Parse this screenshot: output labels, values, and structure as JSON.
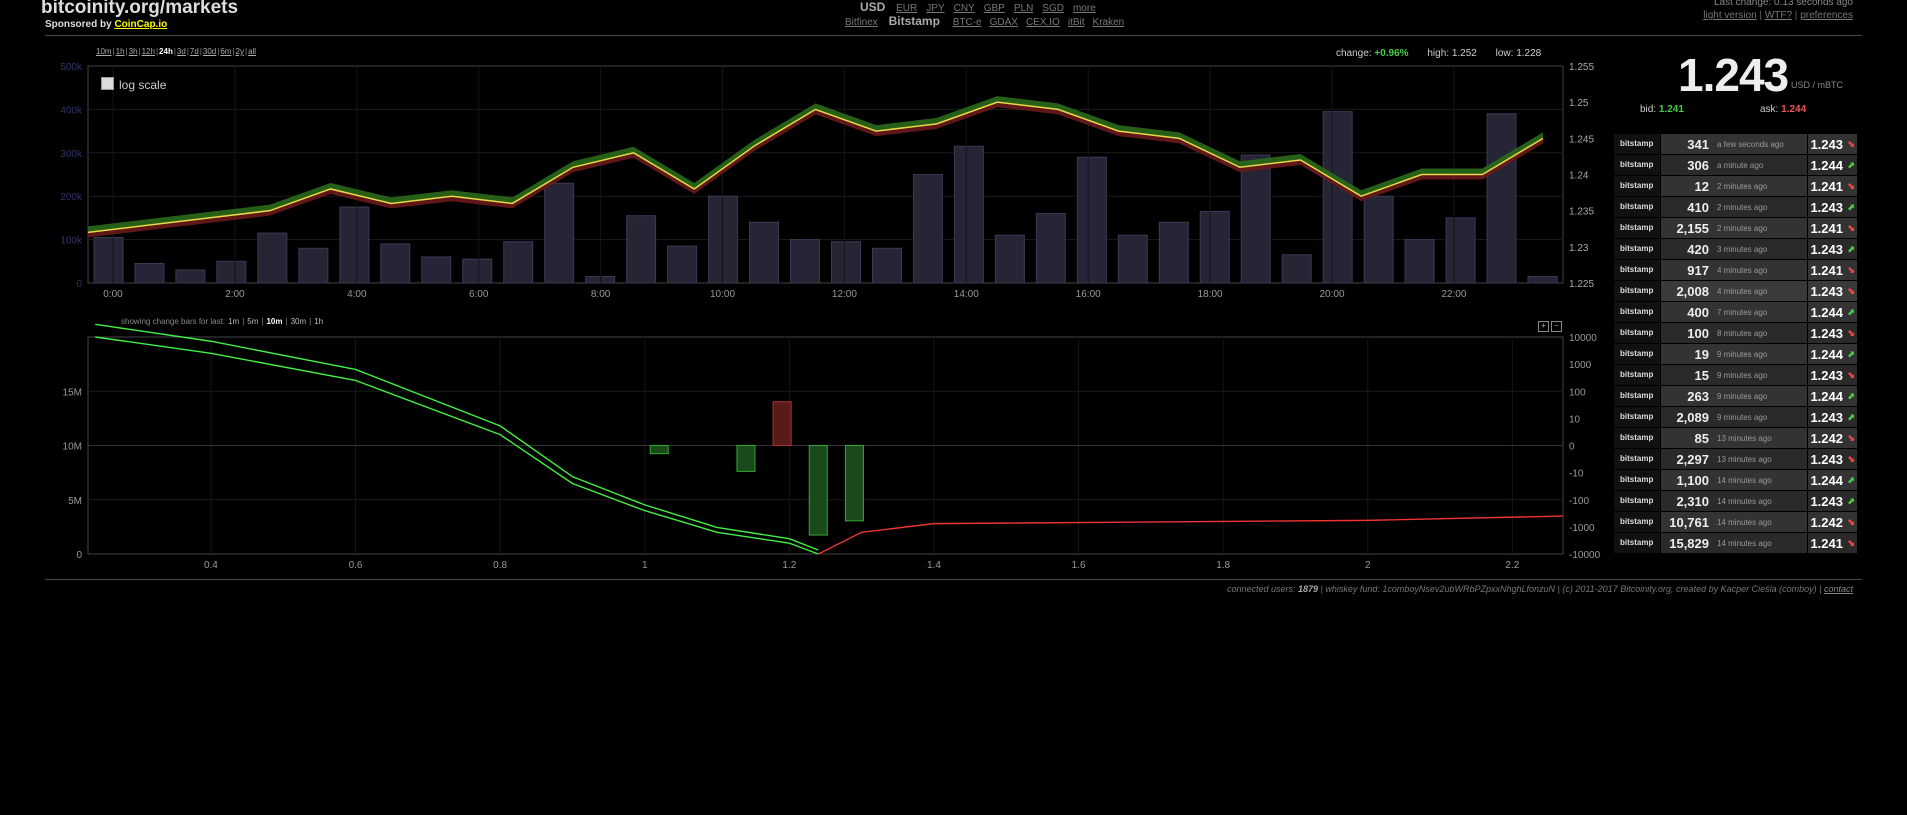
{
  "header": {
    "title": "bitcoinity.org/markets",
    "sponsor_prefix": "Sponsored by ",
    "sponsor_link": "CoinCap.io",
    "currency_active": "USD",
    "currencies": [
      "EUR",
      "JPY",
      "CNY",
      "GBP",
      "PLN",
      "SGD",
      "more"
    ],
    "exchange_first": "Bitfinex",
    "exchange_active": "Bitstamp",
    "exchanges": [
      "BTC-e",
      "GDAX",
      "CEX.IO",
      "itBit",
      "Kraken"
    ],
    "last_change": "Last change: 0.13 seconds ago",
    "link_light": "light version",
    "link_wtf": "WTF?",
    "link_prefs": "preferences"
  },
  "range": {
    "options": [
      "10m",
      "1h",
      "3h",
      "12h",
      "24h",
      "3d",
      "7d",
      "30d",
      "6m",
      "2y",
      "all"
    ],
    "current": "24h"
  },
  "stats": {
    "change_label": "change:",
    "change_value": "+0.96%",
    "high_label": "high:",
    "high_value": "1.252",
    "low_label": "low:",
    "low_value": "1.228"
  },
  "log_scale_label": "log scale",
  "change_bars": {
    "label": "showing change bars for last:",
    "options": [
      "1m",
      "5m",
      "10m",
      "30m",
      "1h"
    ],
    "current": "10m"
  },
  "ticker": {
    "price": "1.243",
    "unit": "USD / mBTC",
    "bid_label": "bid:",
    "bid": "1.241",
    "ask_label": "ask:",
    "ask": "1.244"
  },
  "trades": [
    {
      "exchange": "bitstamp",
      "amount": "341",
      "time": "a few seconds ago",
      "price": "1.243",
      "dir": "down"
    },
    {
      "exchange": "bitstamp",
      "amount": "306",
      "time": "a minute ago",
      "price": "1.244",
      "dir": "up"
    },
    {
      "exchange": "bitstamp",
      "amount": "12",
      "time": "2 minutes ago",
      "price": "1.241",
      "dir": "down"
    },
    {
      "exchange": "bitstamp",
      "amount": "410",
      "time": "2 minutes ago",
      "price": "1.243",
      "dir": "up"
    },
    {
      "exchange": "bitstamp",
      "amount": "2,155",
      "time": "2 minutes ago",
      "price": "1.241",
      "dir": "down"
    },
    {
      "exchange": "bitstamp",
      "amount": "420",
      "time": "3 minutes ago",
      "price": "1.243",
      "dir": "up"
    },
    {
      "exchange": "bitstamp",
      "amount": "917",
      "time": "4 minutes ago",
      "price": "1.241",
      "dir": "down"
    },
    {
      "exchange": "bitstamp",
      "amount": "2,008",
      "time": "4 minutes ago",
      "price": "1.243",
      "dir": "down"
    },
    {
      "exchange": "bitstamp",
      "amount": "400",
      "time": "7 minutes ago",
      "price": "1.244",
      "dir": "up"
    },
    {
      "exchange": "bitstamp",
      "amount": "100",
      "time": "8 minutes ago",
      "price": "1.243",
      "dir": "down"
    },
    {
      "exchange": "bitstamp",
      "amount": "19",
      "time": "9 minutes ago",
      "price": "1.244",
      "dir": "up"
    },
    {
      "exchange": "bitstamp",
      "amount": "15",
      "time": "9 minutes ago",
      "price": "1.243",
      "dir": "down"
    },
    {
      "exchange": "bitstamp",
      "amount": "263",
      "time": "9 minutes ago",
      "price": "1.244",
      "dir": "up"
    },
    {
      "exchange": "bitstamp",
      "amount": "2,089",
      "time": "9 minutes ago",
      "price": "1.243",
      "dir": "up"
    },
    {
      "exchange": "bitstamp",
      "amount": "85",
      "time": "13 minutes ago",
      "price": "1.242",
      "dir": "down"
    },
    {
      "exchange": "bitstamp",
      "amount": "2,297",
      "time": "13 minutes ago",
      "price": "1.243",
      "dir": "down"
    },
    {
      "exchange": "bitstamp",
      "amount": "1,100",
      "time": "14 minutes ago",
      "price": "1.244",
      "dir": "up"
    },
    {
      "exchange": "bitstamp",
      "amount": "2,310",
      "time": "14 minutes ago",
      "price": "1.243",
      "dir": "up"
    },
    {
      "exchange": "bitstamp",
      "amount": "10,761",
      "time": "14 minutes ago",
      "price": "1.242",
      "dir": "down"
    },
    {
      "exchange": "bitstamp",
      "amount": "15,829",
      "time": "14 minutes ago",
      "price": "1.241",
      "dir": "down"
    }
  ],
  "footer": {
    "users_label": "connected users: ",
    "users": "1879",
    "fund": " | whiskey fund: 1comboyNsev2ubWRbPZpxxNhghLfonzuN | (c) 2011-2017 Bitcoinity.org, created by Kacper Cieśla (comboy) | ",
    "contact": "contact"
  },
  "colors": {
    "price_line": "#e8d84a",
    "up_fill": "#2a6a1a",
    "down_fill": "#6a1a1a",
    "volume_bar": "#252535",
    "bids_line": "#44ee44",
    "asks_line": "#ee3333"
  },
  "chart_data": [
    {
      "type": "line",
      "title": "",
      "x": [
        "0:00",
        "2:00",
        "4:00",
        "6:00",
        "8:00",
        "10:00",
        "12:00",
        "14:00",
        "16:00",
        "18:00",
        "20:00",
        "22:00"
      ],
      "price_series": [
        1.232,
        1.233,
        1.234,
        1.235,
        1.238,
        1.236,
        1.237,
        1.236,
        1.241,
        1.243,
        1.238,
        1.244,
        1.249,
        1.246,
        1.247,
        1.25,
        1.249,
        1.246,
        1.245,
        1.241,
        1.242,
        1.237,
        1.24,
        1.24,
        1.245
      ],
      "volume_series": [
        105000,
        45000,
        30000,
        50000,
        115000,
        80000,
        175000,
        90000,
        60000,
        55000,
        95000,
        230000,
        15000,
        155000,
        85000,
        200000,
        140000,
        100000,
        95000,
        80000,
        250000,
        315000,
        110000,
        160000,
        290000,
        110000,
        140000,
        165000,
        295000,
        65000,
        395000,
        200000,
        100000,
        150000,
        390000,
        15000
      ],
      "left_axis": {
        "ticks": [
          "500k",
          "400k",
          "300k",
          "200k",
          "100k",
          "0"
        ],
        "ylim": [
          0,
          500000
        ]
      },
      "right_axis": {
        "ticks": [
          "1.255",
          "1.25",
          "1.245",
          "1.24",
          "1.235",
          "1.23",
          "1.225"
        ],
        "ylim": [
          1.225,
          1.255
        ]
      }
    },
    {
      "type": "area",
      "title": "",
      "x_ticks": [
        "0.4",
        "0.6",
        "0.8",
        "1",
        "1.2",
        "1.4",
        "1.6",
        "1.8",
        "2",
        "2.2"
      ],
      "xlim": [
        0.23,
        2.27
      ],
      "left_axis": {
        "ticks": [
          "15M",
          "10M",
          "5M",
          "0"
        ],
        "ylim": [
          0,
          20000000
        ]
      },
      "right_axis": {
        "ticks": [
          "10000",
          "1000",
          "100",
          "10",
          "0",
          "-10",
          "-100",
          "-1000",
          "-10000"
        ]
      },
      "bids": [
        [
          0.24,
          20000000
        ],
        [
          0.4,
          18500000
        ],
        [
          0.6,
          16000000
        ],
        [
          0.8,
          11000000
        ],
        [
          0.9,
          6500000
        ],
        [
          1.0,
          4000000
        ],
        [
          1.1,
          2000000
        ],
        [
          1.2,
          1000000
        ],
        [
          1.24,
          0
        ]
      ],
      "asks": [
        [
          1.24,
          0
        ],
        [
          1.3,
          2000000
        ],
        [
          1.4,
          2800000
        ],
        [
          1.8,
          3000000
        ],
        [
          2.0,
          3100000
        ],
        [
          2.27,
          3500000
        ]
      ],
      "change_bars": [
        [
          1.02,
          -1
        ],
        [
          1.14,
          -8
        ],
        [
          1.19,
          40
        ],
        [
          1.24,
          -2000
        ],
        [
          1.29,
          -600
        ]
      ]
    }
  ]
}
